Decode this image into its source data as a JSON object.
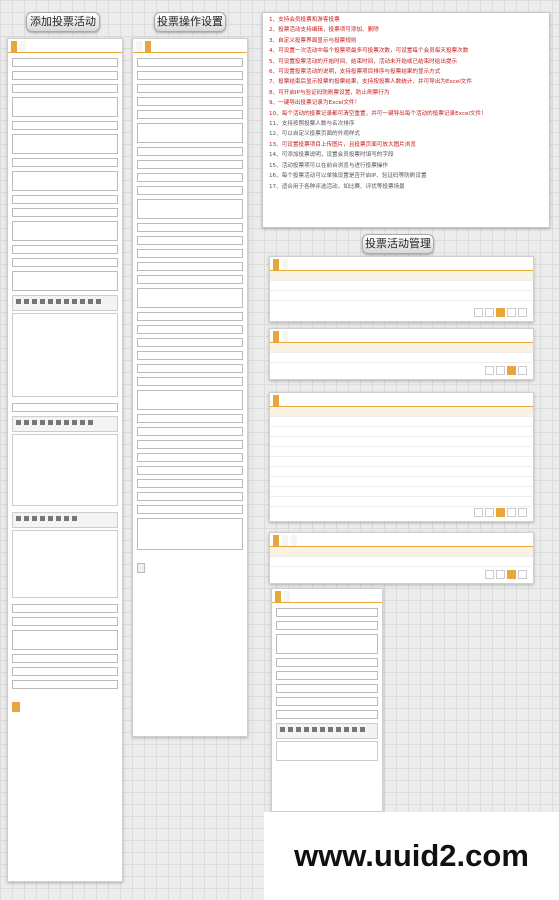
{
  "labels": {
    "add_activity": "添加投票活动",
    "vote_settings": "投票操作设置",
    "vote_mgmt": "投票活动管理"
  },
  "notes": [
    {
      "text": "1、支持会员投票和游客投票",
      "color": "red"
    },
    {
      "text": "2、投票活动支持编辑，投票项可添加、删除",
      "color": "red"
    },
    {
      "text": "3、自定义投票界面显示与投票规则",
      "color": "red"
    },
    {
      "text": "4、可设置一次活动中每个投票项最多可投票次数，可设置每个会员每天投票次数",
      "color": "red"
    },
    {
      "text": "5、可设置投票活动的开始时间、结束时间，活动未开始或已结束时给出提示",
      "color": "red"
    },
    {
      "text": "6、可设置投票活动的说明，支持投票项目排序与投票结果的显示方式",
      "color": "red"
    },
    {
      "text": "7、投票结束后显示投票的投票结果，支持按投票人数统计，并可导出为Excel文件",
      "color": "red"
    },
    {
      "text": "8、可开启IP与验证码防刷票设置，防止刷票行为",
      "color": "red"
    },
    {
      "text": "9、一键导出投票记录为Excel文件！",
      "color": "red"
    },
    {
      "text": "10、每个活动的投票记录都可清空重置，并可一键导出每个活动的投票记录Excel文件！",
      "color": "red"
    },
    {
      "text": "11、支持按照投票人数与名次排序",
      "color": "gray"
    },
    {
      "text": "12、可以自定义投票页面的外观样式",
      "color": "gray"
    },
    {
      "text": "13、可设置投票项目上传图片，且投票页面可放大图片浏览",
      "color": "red"
    },
    {
      "text": "14、可添加投票说明，设置会员投票时填写的字段",
      "color": "gray"
    },
    {
      "text": "15、活动投票项可以在前台浏览与进行投票操作",
      "color": "gray"
    },
    {
      "text": "16、每个投票活动可以单独设置是否开启IP、验证码等防刷设置",
      "color": "gray"
    },
    {
      "text": "17、适合用于各种评选活动，如比赛、评优等投票场景",
      "color": "gray"
    }
  ],
  "site_url": "www.uuid2.com"
}
